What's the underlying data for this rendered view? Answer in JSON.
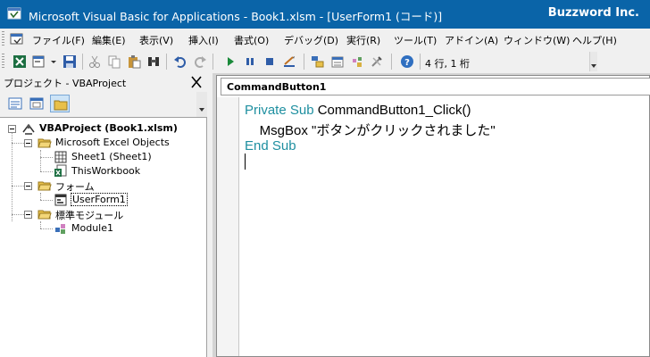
{
  "window": {
    "title": "Microsoft Visual Basic for Applications - Book1.xlsm - [UserForm1 (コード)]",
    "brand": "Buzzword Inc.",
    "title_bar_color": "#0a64a8"
  },
  "menu": {
    "items": [
      "ファイル(F)",
      "編集(E)",
      "表示(V)",
      "挿入(I)",
      "書式(O)",
      "デバッグ(D)",
      "実行(R)",
      "ツール(T)",
      "アドイン(A)",
      "ウィンドウ(W)",
      "ヘルプ(H)"
    ]
  },
  "toolbar": {
    "buttons": [
      "excel-view",
      "insert-userform",
      "save",
      "cut",
      "copy",
      "paste",
      "find",
      "undo",
      "redo",
      "run",
      "break",
      "reset",
      "design-mode",
      "project-explorer",
      "properties-window",
      "object-browser",
      "toolbox",
      "help"
    ],
    "cursor_position": "4 行, 1 桁"
  },
  "project": {
    "header": "プロジェクト - VBAProject",
    "close_glyph": "✕",
    "view_buttons": [
      "view-code",
      "view-object",
      "toggle-folders"
    ],
    "tree": {
      "root": "VBAProject (Book1.xlsm)",
      "excel_objects_folder": "Microsoft Excel Objects",
      "sheet1": "Sheet1 (Sheet1)",
      "thisworkbook": "ThisWorkbook",
      "forms_folder": "フォーム",
      "userform1": "UserForm1",
      "modules_folder": "標準モジュール",
      "module1": "Module1"
    }
  },
  "code": {
    "object_combo": "CommandButton1",
    "lines": [
      {
        "kw": "Private Sub",
        "text": " CommandButton1_Click()"
      },
      {
        "kw": "",
        "text": "    MsgBox \"ボタンがクリックされました\""
      },
      {
        "kw": "End Sub",
        "text": ""
      }
    ],
    "keyword_color": "#1e8fa0"
  }
}
